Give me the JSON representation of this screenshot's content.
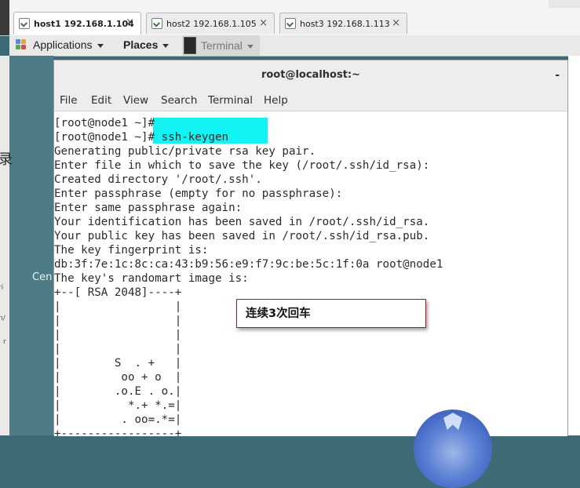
{
  "tabs": [
    {
      "label": "host1 192.168.1.104",
      "active": true
    },
    {
      "label": "host2 192.168.1.105",
      "active": false
    },
    {
      "label": "host3 192.168.1.113",
      "active": false
    }
  ],
  "tab_close_glyph": "×",
  "panel": {
    "applications": "Applications",
    "places": "Places",
    "terminal": "Terminal"
  },
  "desktop": {
    "partial_char": "录",
    "partial_word": "Cen",
    "small_a": "ri",
    "small_b": "n/",
    "small_c": "r"
  },
  "window": {
    "title": "root@localhost:~",
    "minimize": "-"
  },
  "menu": [
    "File",
    "Edit",
    "View",
    "Search",
    "Terminal",
    "Help"
  ],
  "terminal_lines": [
    "[root@node1 ~]#",
    "[root@node1 ~]# ssh-keygen",
    "Generating public/private rsa key pair.",
    "Enter file in which to save the key (/root/.ssh/id_rsa):",
    "Created directory '/root/.ssh'.",
    "Enter passphrase (empty for no passphrase):",
    "Enter same passphrase again:",
    "Your identification has been saved in /root/.ssh/id_rsa.",
    "Your public key has been saved in /root/.ssh/id_rsa.pub.",
    "The key fingerprint is:",
    "db:3f:7e:1c:8c:ca:43:b9:56:e9:f7:9c:be:5c:1f:0a root@node1",
    "The key's randomart image is:",
    "+--[ RSA 2048]----+",
    "|                 |",
    "|                 |",
    "|                 |",
    "|                 |",
    "|        S  . +   |",
    "|         oo + o  |",
    "|        .o.E . o.|",
    "|          *.+ *.=|",
    "|         . oo=.*=|",
    "+-----------------+"
  ],
  "annotation": "连续3次回车",
  "colors": {
    "highlight": "#00f2f2",
    "annotation_border": "#b01818",
    "desktop": "#4d7c86"
  }
}
